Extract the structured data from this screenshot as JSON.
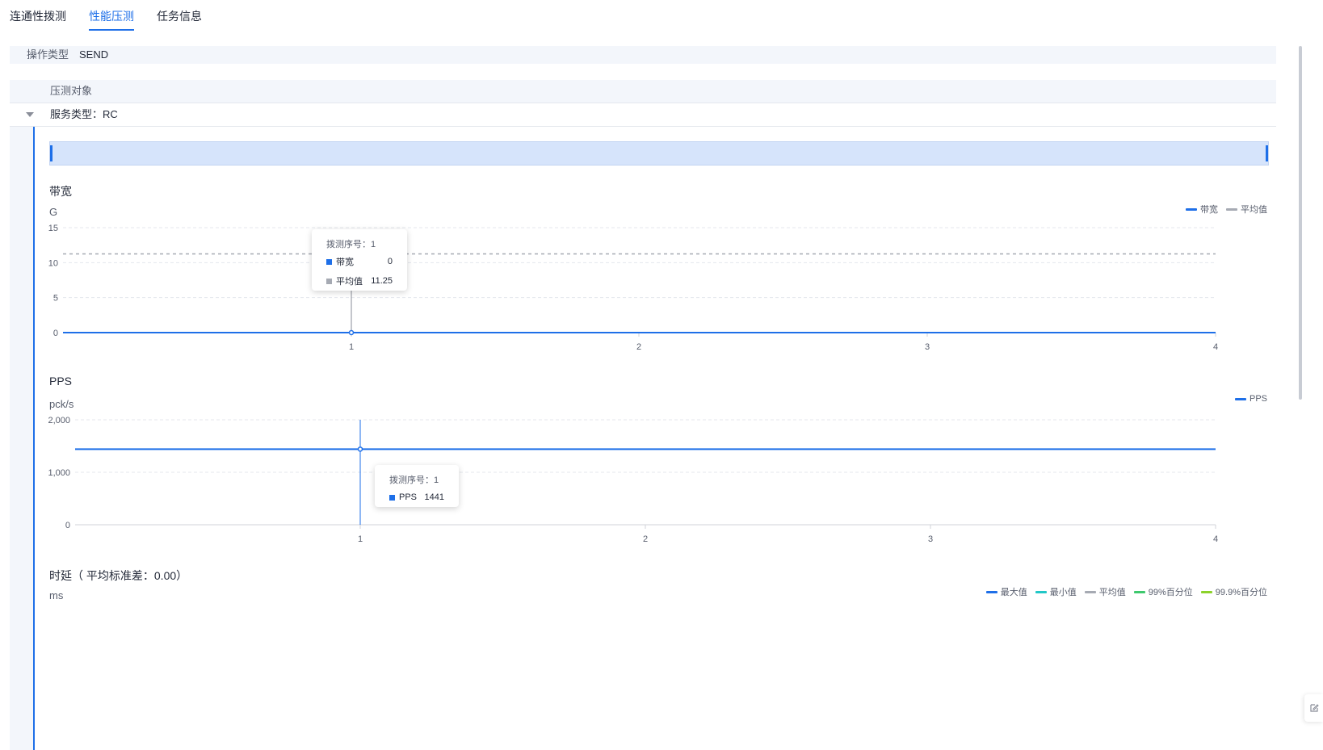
{
  "tabs": [
    {
      "label": "连通性拨测",
      "active": false
    },
    {
      "label": "性能压测",
      "active": true
    },
    {
      "label": "任务信息",
      "active": false
    }
  ],
  "operation": {
    "label": "操作类型",
    "value": "SEND"
  },
  "table": {
    "header": "压测对象",
    "group_label": "服务类型：RC"
  },
  "colors": {
    "accent": "#1e6fe8",
    "avg": "#a6aab3",
    "min": "#21c7c7",
    "p99": "#3ec86d",
    "p999": "#8cd22a"
  },
  "charts": {
    "bandwidth": {
      "title": "带宽",
      "unit": "G",
      "legend": [
        {
          "name": "带宽"
        },
        {
          "name": "平均值"
        }
      ]
    },
    "pps": {
      "title": "PPS",
      "unit": "pck/s",
      "legend": [
        {
          "name": "PPS"
        }
      ]
    },
    "latency": {
      "title": "时延（ 平均标准差：0.00）",
      "unit": "ms",
      "legend": [
        {
          "name": "最大值"
        },
        {
          "name": "最小值"
        },
        {
          "name": "平均值"
        },
        {
          "name": "99%百分位"
        },
        {
          "name": "99.9%百分位"
        }
      ]
    }
  },
  "tooltips": {
    "bandwidth": {
      "title": "拨测序号：1",
      "rows": [
        {
          "name": "带宽",
          "value": "0"
        },
        {
          "name": "平均值",
          "value": "11.25"
        }
      ]
    },
    "pps": {
      "title": "拨测序号：1",
      "rows": [
        {
          "name": "PPS",
          "value": "1441"
        }
      ]
    }
  },
  "chart_data": [
    {
      "type": "line",
      "title": "带宽",
      "ylabel": "G",
      "x": [
        1,
        2,
        3,
        4
      ],
      "xticks": [
        "1",
        "2",
        "3",
        "4"
      ],
      "yticks": [
        "0",
        "5",
        "10",
        "15"
      ],
      "ylim": [
        0,
        15
      ],
      "grid": true,
      "legend_position": "top-right",
      "series": [
        {
          "name": "带宽",
          "values": [
            0,
            0,
            0,
            0
          ]
        },
        {
          "name": "平均值",
          "values": [
            11.25,
            11.25,
            11.25,
            11.25
          ],
          "style": "dashed"
        }
      ]
    },
    {
      "type": "line",
      "title": "PPS",
      "ylabel": "pck/s",
      "x": [
        1,
        2,
        3,
        4
      ],
      "xticks": [
        "1",
        "2",
        "3",
        "4"
      ],
      "yticks": [
        "0",
        "1,000",
        "2,000"
      ],
      "ylim": [
        0,
        2000
      ],
      "grid": true,
      "legend_position": "top-right",
      "series": [
        {
          "name": "PPS",
          "values": [
            1441,
            1441,
            1441,
            1441
          ]
        }
      ]
    }
  ]
}
